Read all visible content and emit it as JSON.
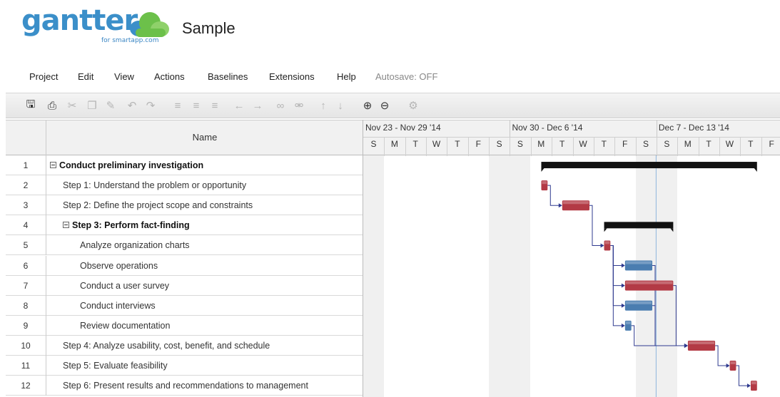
{
  "app": {
    "logo_text": "gantter",
    "logo_sub": "for smartapp.com",
    "doc_title": "Sample"
  },
  "menu": {
    "items": [
      "Project",
      "Edit",
      "View",
      "Actions",
      "Baselines",
      "Extensions",
      "Help"
    ],
    "autosave": "Autosave: OFF"
  },
  "toolbar": {
    "buttons": [
      {
        "icon": "save-icon",
        "glyph": "🖫",
        "enabled": true
      },
      {
        "icon": "print-icon",
        "glyph": "⎙",
        "enabled": true
      },
      {
        "icon": "cut-icon",
        "glyph": "✂",
        "enabled": false
      },
      {
        "icon": "copy-icon",
        "glyph": "❐",
        "enabled": false
      },
      {
        "icon": "paste-icon",
        "glyph": "✎",
        "enabled": false
      },
      {
        "icon": "undo-icon",
        "glyph": "↶",
        "enabled": false
      },
      {
        "icon": "redo-icon",
        "glyph": "↷",
        "enabled": false
      },
      {
        "icon": "align-left-icon",
        "glyph": "≡",
        "enabled": false
      },
      {
        "icon": "align-center-icon",
        "glyph": "≡",
        "enabled": false
      },
      {
        "icon": "align-right-icon",
        "glyph": "≡",
        "enabled": false
      },
      {
        "icon": "outdent-icon",
        "glyph": "←",
        "enabled": false
      },
      {
        "icon": "indent-icon",
        "glyph": "→",
        "enabled": false
      },
      {
        "icon": "link-icon",
        "glyph": "∞",
        "enabled": false
      },
      {
        "icon": "unlink-icon",
        "glyph": "⚮",
        "enabled": false
      },
      {
        "icon": "move-up-icon",
        "glyph": "↑",
        "enabled": false
      },
      {
        "icon": "move-down-icon",
        "glyph": "↓",
        "enabled": false
      },
      {
        "icon": "zoom-in-icon",
        "glyph": "⊕",
        "enabled": true
      },
      {
        "icon": "zoom-out-icon",
        "glyph": "⊖",
        "enabled": true
      },
      {
        "icon": "settings-icon",
        "glyph": "⚙",
        "enabled": false
      }
    ]
  },
  "grid": {
    "name_header": "Name",
    "rows": [
      {
        "num": "1",
        "name": "Conduct preliminary investigation",
        "level": 0,
        "summary": true
      },
      {
        "num": "2",
        "name": "Step 1: Understand the problem or opportunity",
        "level": 1,
        "summary": false
      },
      {
        "num": "3",
        "name": "Step 2: Define the project scope and constraints",
        "level": 1,
        "summary": false
      },
      {
        "num": "4",
        "name": "Step 3: Perform fact-finding",
        "level": 1,
        "summary": true
      },
      {
        "num": "5",
        "name": "Analyze organization charts",
        "level": 2,
        "summary": false
      },
      {
        "num": "6",
        "name": "Observe operations",
        "level": 2,
        "summary": false
      },
      {
        "num": "7",
        "name": "Conduct a user survey",
        "level": 2,
        "summary": false
      },
      {
        "num": "8",
        "name": "Conduct interviews",
        "level": 2,
        "summary": false
      },
      {
        "num": "9",
        "name": "Review documentation",
        "level": 2,
        "summary": false
      },
      {
        "num": "10",
        "name": "Step 4: Analyze usability, cost, benefit, and schedule",
        "level": 1,
        "summary": false
      },
      {
        "num": "11",
        "name": "Step 5: Evaluate feasibility",
        "level": 1,
        "summary": false
      },
      {
        "num": "12",
        "name": "Step 6: Present results and recommendations to management",
        "level": 1,
        "summary": false
      }
    ]
  },
  "timeline": {
    "weeks": [
      "Nov 23 - Nov 29 '14",
      "Nov 30 - Dec 6 '14",
      "Dec 7 - Dec 13 '14"
    ],
    "days": [
      "S",
      "M",
      "T",
      "W",
      "T",
      "F",
      "S",
      "S",
      "M",
      "T",
      "W",
      "T",
      "F",
      "S",
      "S",
      "M",
      "T",
      "W",
      "T",
      "F"
    ],
    "today_day_index": 14,
    "colors": {
      "summary": "#111111",
      "critical_task": "#b33a45",
      "task": "#4a7db0",
      "link": "#2f3a8f",
      "today": "#8fb6dd"
    },
    "bars": [
      {
        "row": 0,
        "start": 8.5,
        "end": 18.8,
        "kind": "summary"
      },
      {
        "row": 1,
        "start": 8.5,
        "end": 8.8,
        "kind": "critical"
      },
      {
        "row": 2,
        "start": 9.5,
        "end": 10.8,
        "kind": "critical"
      },
      {
        "row": 3,
        "start": 11.5,
        "end": 14.8,
        "kind": "summary"
      },
      {
        "row": 4,
        "start": 11.5,
        "end": 11.8,
        "kind": "critical"
      },
      {
        "row": 5,
        "start": 12.5,
        "end": 13.8,
        "kind": "task"
      },
      {
        "row": 6,
        "start": 12.5,
        "end": 14.8,
        "kind": "critical"
      },
      {
        "row": 7,
        "start": 12.5,
        "end": 13.8,
        "kind": "task"
      },
      {
        "row": 8,
        "start": 12.5,
        "end": 12.8,
        "kind": "task"
      },
      {
        "row": 9,
        "start": 15.5,
        "end": 16.8,
        "kind": "critical"
      },
      {
        "row": 10,
        "start": 17.5,
        "end": 17.8,
        "kind": "critical"
      },
      {
        "row": 11,
        "start": 18.5,
        "end": 18.8,
        "kind": "critical"
      }
    ],
    "links": [
      {
        "from": 1,
        "to": 2
      },
      {
        "from": 2,
        "to": 4
      },
      {
        "from": 4,
        "to": 5
      },
      {
        "from": 4,
        "to": 6
      },
      {
        "from": 4,
        "to": 7
      },
      {
        "from": 4,
        "to": 8
      },
      {
        "from": 5,
        "to": 9
      },
      {
        "from": 6,
        "to": 9
      },
      {
        "from": 7,
        "to": 9
      },
      {
        "from": 8,
        "to": 9
      },
      {
        "from": 9,
        "to": 10
      },
      {
        "from": 10,
        "to": 11
      }
    ]
  }
}
